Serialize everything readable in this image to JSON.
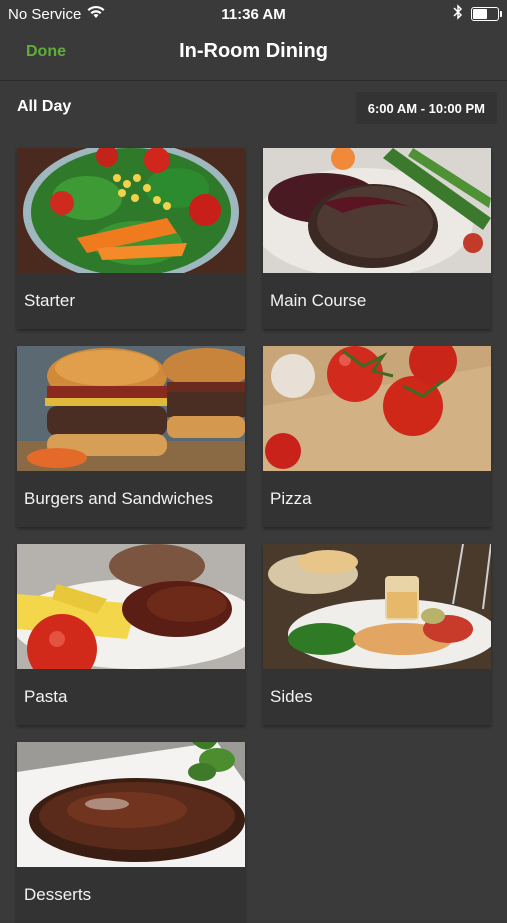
{
  "status_bar": {
    "carrier": "No Service",
    "time": "11:36 AM",
    "battery_level": 0.55,
    "icons": [
      "wifi-icon",
      "bluetooth-icon",
      "battery-icon"
    ]
  },
  "nav": {
    "done_label": "Done",
    "title": "In-Room Dining"
  },
  "schedule": {
    "label": "All Day",
    "hours": "6:00 AM - 10:00 PM"
  },
  "categories": [
    {
      "label": "Starter"
    },
    {
      "label": "Main Course"
    },
    {
      "label": "Burgers and Sandwiches"
    },
    {
      "label": "Pizza"
    },
    {
      "label": "Pasta"
    },
    {
      "label": "Sides"
    },
    {
      "label": "Desserts"
    }
  ],
  "colors": {
    "background": "#3a3a3a",
    "card": "#333333",
    "accent": "#5fae3a"
  }
}
